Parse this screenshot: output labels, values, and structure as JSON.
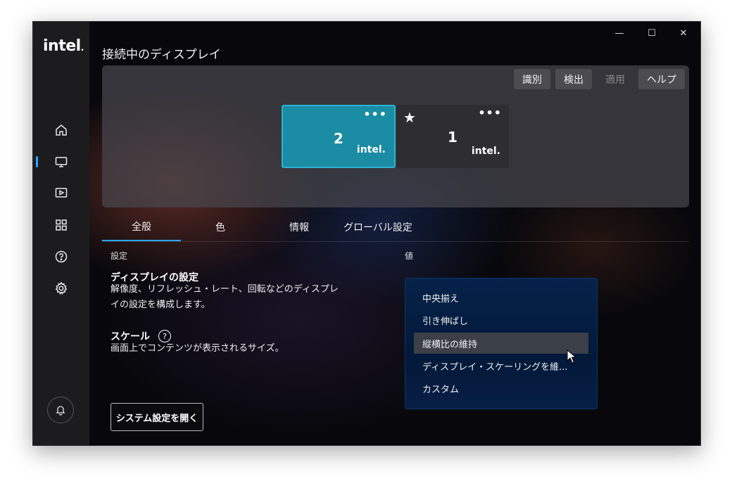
{
  "brand": {
    "logo_text": "intel",
    "logo_dot": "."
  },
  "window": {
    "title": "接続中のディスプレイ",
    "controls": {
      "minimize": "—",
      "maximize": "☐",
      "close": "✕"
    }
  },
  "sidebar": {
    "items": [
      {
        "name": "home",
        "icon": "home-icon"
      },
      {
        "name": "display",
        "icon": "monitor-icon",
        "active": true
      },
      {
        "name": "media",
        "icon": "video-icon"
      },
      {
        "name": "apps",
        "icon": "grid-icon"
      },
      {
        "name": "help",
        "icon": "help-icon"
      },
      {
        "name": "settings",
        "icon": "gear-icon"
      }
    ],
    "notification_icon": "bell-icon",
    "accent": "#2aa6ff"
  },
  "display_panel": {
    "buttons": {
      "identify": "識別",
      "detect": "検出",
      "apply": "適用",
      "help": "ヘルプ"
    },
    "monitors": [
      {
        "number": "2",
        "brand": "intel.",
        "menu": "•••",
        "selected": true,
        "color": "#1a8ca3"
      },
      {
        "number": "1",
        "brand": "intel.",
        "menu": "•••",
        "primary_star": "★"
      }
    ]
  },
  "tabs": [
    {
      "label": "全般",
      "active": true
    },
    {
      "label": "色"
    },
    {
      "label": "情報"
    },
    {
      "label": "グローバル設定"
    }
  ],
  "columns": {
    "setting": "設定",
    "value": "値"
  },
  "sections": {
    "display_settings": {
      "title": "ディスプレイの設定",
      "desc_line1": "解像度、リフレッシュ・レート、回転などのディスプレ",
      "desc_line2": "イの設定を構成します。"
    },
    "scale": {
      "title": "スケール",
      "help": "?",
      "desc": "画面上でコンテンツが表示されるサイズ。"
    }
  },
  "open_system_settings": "システム設定を開く",
  "scale_dropdown": {
    "options": [
      "中央揃え",
      "引き伸ばし",
      "縦横比の維持",
      "ディスプレイ・スケーリングを維...",
      "カスタム"
    ],
    "hovered": "縦横比の維持"
  }
}
